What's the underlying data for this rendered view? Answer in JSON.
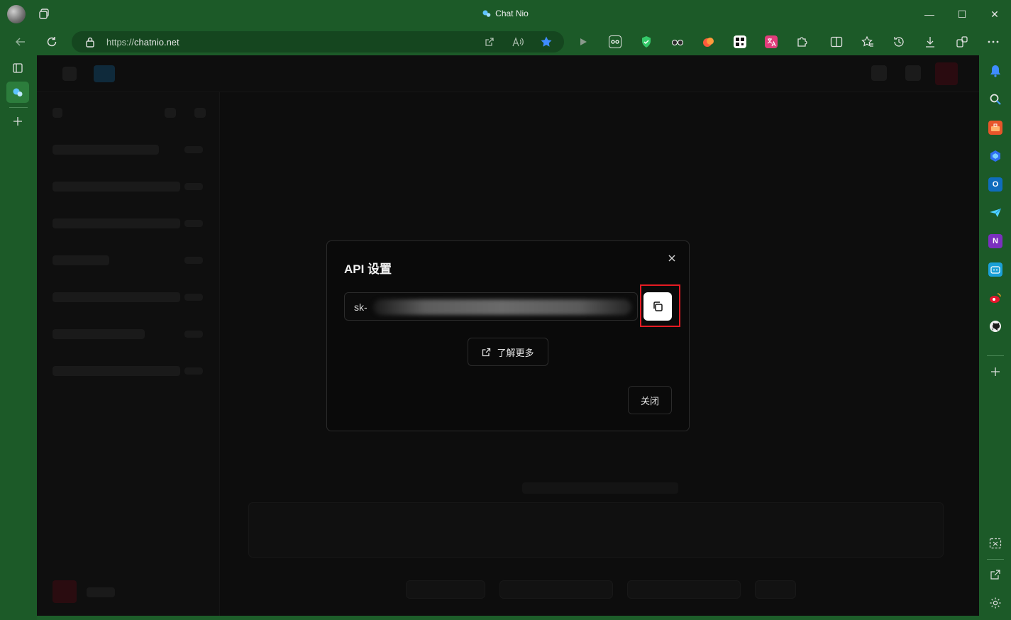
{
  "window": {
    "title": "Chat Nio",
    "controls": {
      "minimize": "—",
      "maximize": "☐",
      "close": "✕"
    }
  },
  "addressbar": {
    "protocol": "https://",
    "host": "chatnio.net"
  },
  "colors": {
    "chrome": "#1c5a28",
    "page": "#0d0d0d",
    "accent_red": "#e51b23",
    "copy_button_bg": "#ffffff"
  },
  "modal": {
    "title": "API 设置",
    "key_prefix": "sk-",
    "learn_more_label": "了解更多",
    "close_label": "关闭"
  },
  "extensions": [
    "play-icon",
    "ublock-icon",
    "shield-icon",
    "glasses-icon",
    "orange-icon",
    "qr-icon",
    "translate-icon",
    "puzzle-icon"
  ],
  "sidebar_right": [
    "bell-icon",
    "search-icon",
    "toolbox-icon",
    "copilot-icon",
    "outlook-icon",
    "send-icon",
    "onenote-icon",
    "bilibili-icon",
    "weibo-icon",
    "github-icon"
  ]
}
